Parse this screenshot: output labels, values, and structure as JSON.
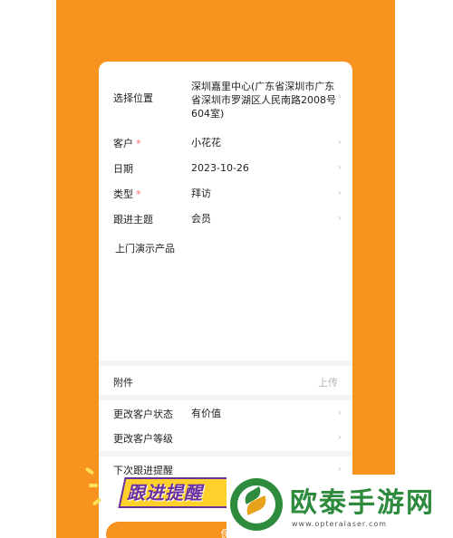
{
  "form": {
    "location": {
      "label": "选择位置",
      "value": "深圳嘉里中心(广东省深圳市广东省深圳市罗湖区人民南路2008号604室)"
    },
    "customer": {
      "label": "客户",
      "required": "*",
      "value": "小花花"
    },
    "date": {
      "label": "日期",
      "value": "2023-10-26"
    },
    "type": {
      "label": "类型",
      "required": "*",
      "value": "拜访"
    },
    "topic": {
      "label": "跟进主题",
      "value": "会员"
    },
    "note": "上门演示产品",
    "attachment": {
      "label": "附件",
      "action": "上传"
    },
    "status": {
      "label": "更改客户状态",
      "value": "有价值"
    },
    "level": {
      "label": "更改客户等级"
    },
    "reminder": {
      "label": "下次跟进提醒"
    },
    "save": "保"
  },
  "icons": {
    "chevron": "chevron-right-icon"
  },
  "overlay": {
    "banner": "跟进提醒",
    "watermark_title": "欧泰手游网",
    "watermark_url": "www.opteralaser.com"
  },
  "colors": {
    "accent": "#f7931e",
    "watermark": "#2e8b3e"
  }
}
